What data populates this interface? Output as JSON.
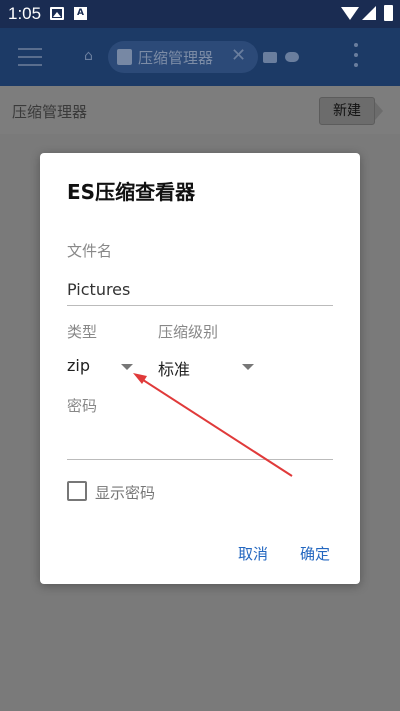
{
  "status_bar": {
    "time": "1:05",
    "icons": [
      "gallery-icon",
      "notification-a-icon",
      "wifi-icon",
      "signal-icon",
      "battery-charging-icon"
    ],
    "notification_letter": "A"
  },
  "app_bar": {
    "active_tab_label": "压缩管理器",
    "icons": [
      "menu-icon",
      "home-icon",
      "archive-icon",
      "close-icon",
      "chat-icon",
      "cloud-icon",
      "more-vert-icon"
    ]
  },
  "breadcrumb": {
    "path": "压缩管理器",
    "new_button_label": "新建"
  },
  "dialog": {
    "title": "ES压缩查看器",
    "filename_label": "文件名",
    "filename_value": "Pictures",
    "type_label": "类型",
    "type_value": "zip",
    "level_label": "压缩级别",
    "level_value": "标准",
    "password_label": "密码",
    "password_value": "",
    "show_password_label": "显示密码",
    "show_password_checked": false,
    "cancel_label": "取消",
    "ok_label": "确定"
  },
  "colors": {
    "accent": "#2367c0",
    "annotation_arrow": "#e03a3a",
    "app_bar": "#1c3a66",
    "scrim": "#7a7a7a"
  }
}
